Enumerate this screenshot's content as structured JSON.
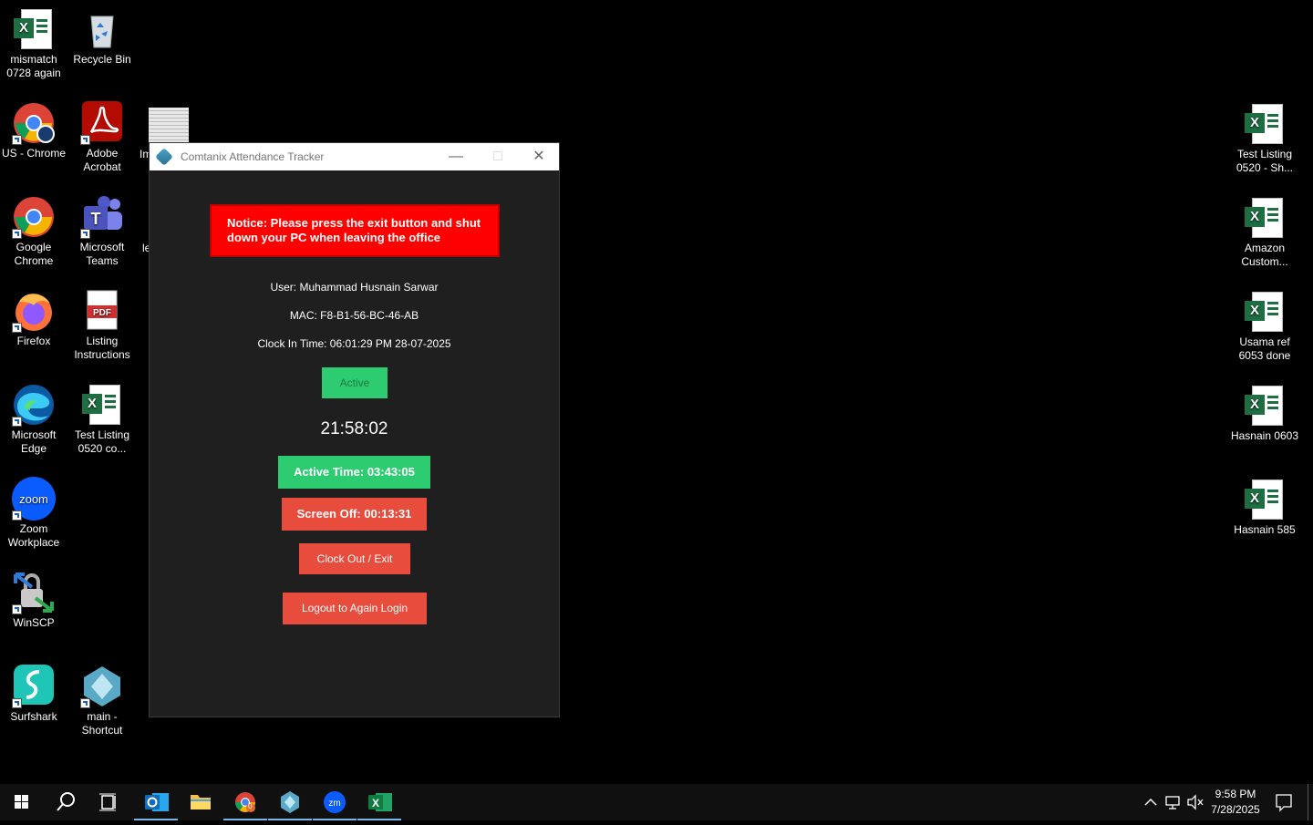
{
  "desktop": {
    "icons_left": [
      {
        "label": "mismatch 0728 again",
        "icon": "excel-icon"
      },
      {
        "label": "Recycle Bin",
        "icon": "recycle-bin-icon"
      },
      {
        "label": "US - Chrome",
        "icon": "chrome-profile-icon"
      },
      {
        "label": "Adobe Acrobat",
        "icon": "acrobat-icon"
      },
      {
        "label": "Google Chrome",
        "icon": "chrome-icon"
      },
      {
        "label": "Microsoft Teams",
        "icon": "teams-icon"
      },
      {
        "label": "Firefox",
        "icon": "firefox-icon"
      },
      {
        "label": "Listing Instructions",
        "icon": "pdf-icon"
      },
      {
        "label": "Microsoft Edge",
        "icon": "edge-icon"
      },
      {
        "label": "Test Listing 0520 co...",
        "icon": "excel-icon"
      },
      {
        "label": "Zoom Workplace",
        "icon": "zoom-icon"
      },
      {
        "label": "WinSCP",
        "icon": "winscp-icon"
      },
      {
        "label": "Surfshark",
        "icon": "surfshark-icon"
      },
      {
        "label": "main - Shortcut",
        "icon": "app-shortcut-icon"
      }
    ],
    "partial_labels": [
      "Im",
      "le"
    ],
    "icons_right": [
      {
        "label": "Test Listing 0520 - Sh...",
        "icon": "excel-icon"
      },
      {
        "label": "Amazon Custom...",
        "icon": "excel-icon"
      },
      {
        "label": "Usama ref 6053 done",
        "icon": "excel-icon"
      },
      {
        "label": "Hasnain 0603",
        "icon": "excel-icon"
      },
      {
        "label": "Hasnain 585",
        "icon": "excel-icon"
      }
    ]
  },
  "window": {
    "title": "Comtanix Attendance Tracker",
    "notice": "Notice: Please press the exit button and shut down your PC when leaving the office",
    "user": "User: Muhammad Husnain Sarwar",
    "mac": "MAC: F8-B1-56-BC-46-AB",
    "clock_in": "Clock In Time: 06:01:29 PM 28-07-2025",
    "status": "Active",
    "timer": "21:58:02",
    "active_time": "Active Time: 03:43:05",
    "screen_off": "Screen Off: 00:13:31",
    "clock_out_label": "Clock Out / Exit",
    "logout_label": "Logout to Again Login",
    "colors": {
      "active_green": "#2ecc71",
      "red": "#e74c3c",
      "notice_red": "#ff0000"
    }
  },
  "taskbar": {
    "time": "9:58 PM",
    "date": "7/28/2025",
    "chrome_badge": "0",
    "apps": [
      "windows-start-icon",
      "search-icon",
      "task-view-icon",
      "outlook-icon",
      "file-explorer-icon",
      "chrome-icon",
      "attendance-tracker-icon",
      "zoom-icon",
      "excel-icon"
    ]
  }
}
